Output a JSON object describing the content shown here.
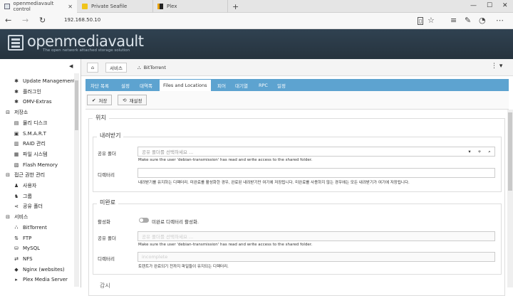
{
  "browser": {
    "tabs": [
      {
        "label": "openmediavault control",
        "icon": "omv-favicon"
      },
      {
        "label": "Private Seafile",
        "icon": "folder-icon"
      },
      {
        "label": "Plex",
        "icon": "plex-icon"
      }
    ],
    "new_tab": "+",
    "url": "192.168.50.10"
  },
  "header": {
    "brand": "openmediavault",
    "tagline": "The open network attached storage solution"
  },
  "sidebar": {
    "items": [
      {
        "label": "Update Management",
        "icon": "puzzle-icon",
        "type": "sub"
      },
      {
        "label": "플러그인",
        "icon": "puzzle-icon",
        "type": "sub"
      },
      {
        "label": "OMV-Extras",
        "icon": "puzzle-icon",
        "type": "sub"
      },
      {
        "label": "저장소",
        "icon": "minus-box-icon",
        "type": "cat"
      },
      {
        "label": "물리 디스크",
        "icon": "disk-icon",
        "type": "sub"
      },
      {
        "label": "S.M.A.R.T",
        "icon": "smart-icon",
        "type": "sub"
      },
      {
        "label": "RAID 관리",
        "icon": "raid-icon",
        "type": "sub"
      },
      {
        "label": "파일 시스템",
        "icon": "filesystem-icon",
        "type": "sub"
      },
      {
        "label": "Flash Memory",
        "icon": "flash-icon",
        "type": "sub"
      },
      {
        "label": "접근 권한 관리",
        "icon": "minus-box-icon",
        "type": "cat"
      },
      {
        "label": "사용자",
        "icon": "user-icon",
        "type": "sub"
      },
      {
        "label": "그룹",
        "icon": "group-icon",
        "type": "sub"
      },
      {
        "label": "공유 폴더",
        "icon": "share-icon",
        "type": "sub"
      },
      {
        "label": "서비스",
        "icon": "minus-box-icon",
        "type": "cat"
      },
      {
        "label": "BitTorrent",
        "icon": "bittorrent-icon",
        "type": "sub"
      },
      {
        "label": "FTP",
        "icon": "ftp-icon",
        "type": "sub"
      },
      {
        "label": "MySQL",
        "icon": "mysql-icon",
        "type": "sub"
      },
      {
        "label": "NFS",
        "icon": "nfs-icon",
        "type": "sub"
      },
      {
        "label": "Nginx (websites)",
        "icon": "nginx-icon",
        "type": "sub"
      },
      {
        "label": "Plex Media Server",
        "icon": "plex-icon",
        "type": "sub"
      }
    ]
  },
  "breadcrumb": {
    "service": "서비스",
    "current": "BitTorrent"
  },
  "tabs": [
    "차단 목록",
    "설정",
    "대역폭",
    "Files and Locations",
    "피어",
    "대기열",
    "RPC",
    "일정"
  ],
  "active_tab": "Files and Locations",
  "toolbar": {
    "save": "저장",
    "reset": "재설정"
  },
  "form": {
    "section": "위치",
    "download": {
      "legend": "내려받기",
      "shared_folder_label": "공유 폴더",
      "shared_folder_placeholder": "공유 폴더를 선택하세요 ...",
      "shared_folder_hint": "Make sure the user 'debian-transmission' has read and write access to the shared folder.",
      "directory_label": "디렉터리",
      "directory_value": "",
      "directory_hint": "내려받기를 유지하는 디렉터리. 미완료를 활성화한 경우, 완료된 내려받기만 여기에 저장됩니다. 미완료를 사용하지 않는 경우에는 모든 내려받기가 여기에 저장됩니다."
    },
    "incomplete": {
      "legend": "미완료",
      "enable_label": "활성화",
      "enable_text": "미완료 디렉터리 활성화.",
      "shared_folder_label": "공유 폴더",
      "shared_folder_placeholder": "공유 폴더를 선택하세요 ...",
      "shared_folder_hint": "Make sure the user 'debian-transmission' has read and write access to the shared folder.",
      "directory_label": "디렉터리",
      "directory_placeholder": "incomplete",
      "directory_hint": "토렌트가 완료되기 전까지 파일들이 유지되는 디렉터리."
    },
    "next_legend": "감시"
  },
  "colors": {
    "header_bg": "#2b3b47",
    "tab_bar": "#5da3d0"
  }
}
